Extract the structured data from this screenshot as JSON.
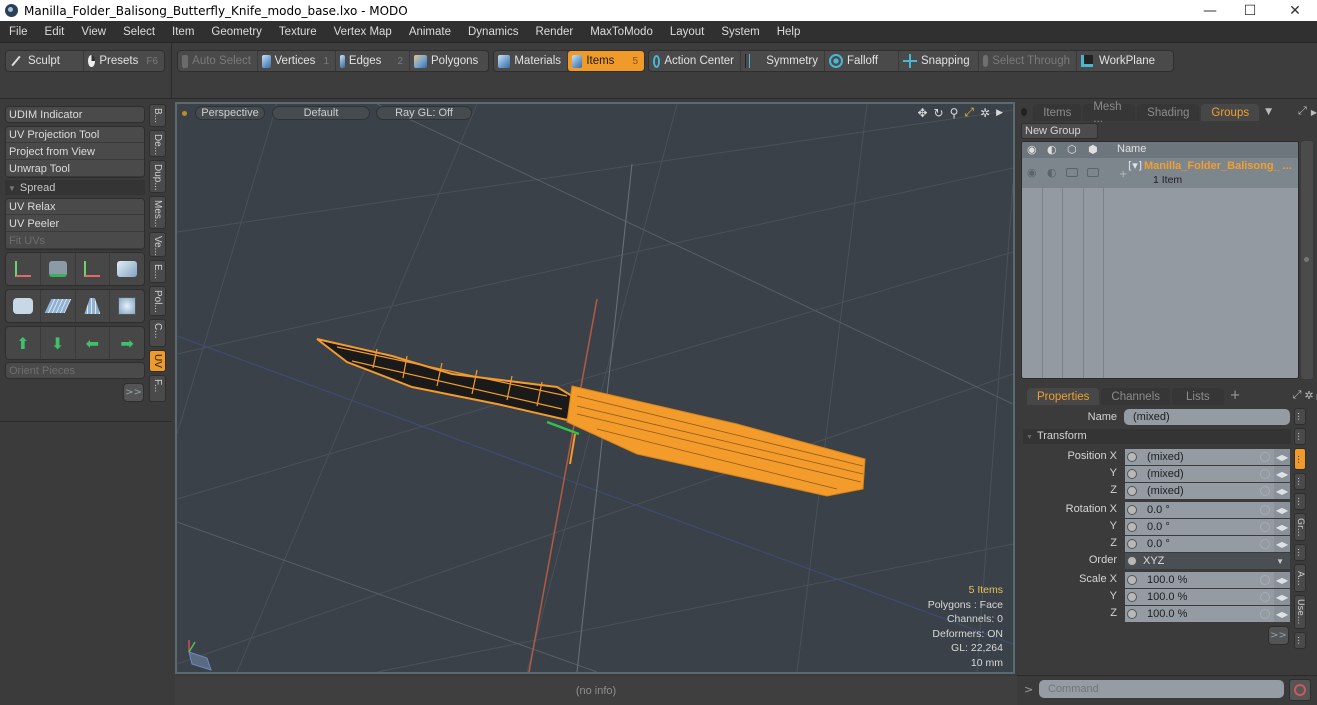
{
  "window": {
    "title": "Manilla_Folder_Balisong_Butterfly_Knife_modo_base.lxo - MODO",
    "controls": {
      "minimize": "—",
      "maximize": "☐",
      "close": "✕"
    }
  },
  "menu": [
    "File",
    "Edit",
    "View",
    "Select",
    "Item",
    "Geometry",
    "Texture",
    "Vertex Map",
    "Animate",
    "Dynamics",
    "Render",
    "MaxToModo",
    "Layout",
    "System",
    "Help"
  ],
  "toolbar": {
    "sculpt": "Sculpt",
    "presets": "Presets",
    "presets_key": "F6",
    "auto_select": "Auto Select",
    "vertices": "Vertices",
    "vertices_key": "1",
    "edges": "Edges",
    "edges_key": "2",
    "polygons": "Polygons",
    "materials": "Materials",
    "items": "Items",
    "items_key": "5",
    "action_center": "Action Center",
    "symmetry": "Symmetry",
    "falloff": "Falloff",
    "snapping": "Snapping",
    "select_through": "Select Through",
    "workplane": "WorkPlane",
    "accent": "#f09a2a"
  },
  "left_panel": {
    "udim": "UDIM Indicator",
    "uv_projection": "UV Projection Tool",
    "project_from_view": "Project from View",
    "unwrap": "Unwrap Tool",
    "spread": "Spread",
    "uv_relax": "UV Relax",
    "uv_peeler": "UV Peeler",
    "fit_uvs": "Fit UVs",
    "orient_pieces": "Orient Pieces",
    "more": ">>",
    "vertical_tabs": [
      "B...",
      "De...",
      "Dup...",
      "Mes...",
      "Ve...",
      "E...",
      "Pol...",
      "C...",
      "UV",
      "F..."
    ],
    "active_tab": "UV"
  },
  "viewport": {
    "view": "Perspective",
    "shading": "Default",
    "raygl": "Ray GL: Off",
    "stats": {
      "items": "5 Items",
      "polygons": "Polygons : Face",
      "channels": "Channels: 0",
      "deformers": "Deformers: ON",
      "gl": "GL: 22,264",
      "unit": "10 mm"
    },
    "wire_color": "#f39b2b"
  },
  "status_bar": {
    "info": "(no info)"
  },
  "groups_panel": {
    "tabs": [
      "Items",
      "Mesh ...",
      "Shading",
      "Groups"
    ],
    "active_tab": "Groups",
    "new_group": "New Group",
    "column_name": "Name",
    "rows": [
      {
        "name": "Manilla_Folder_Balisong_ ...",
        "count": "1 Item"
      }
    ]
  },
  "properties_panel": {
    "tabs": [
      "Properties",
      "Channels",
      "Lists"
    ],
    "active_tab": "Properties",
    "add_tab": "+",
    "name_label": "Name",
    "name_value": "(mixed)",
    "section": "Transform",
    "rows": [
      {
        "label": "Position X",
        "value": "(mixed)"
      },
      {
        "label": "Y",
        "value": "(mixed)"
      },
      {
        "label": "Z",
        "value": "(mixed)"
      },
      {
        "label": "Rotation X",
        "value": "0.0 °"
      },
      {
        "label": "Y",
        "value": "0.0 °"
      },
      {
        "label": "Z",
        "value": "0.0 °"
      },
      {
        "label": "Order",
        "value": "XYZ"
      },
      {
        "label": "Scale X",
        "value": "100.0 %"
      },
      {
        "label": "Y",
        "value": "100.0 %"
      },
      {
        "label": "Z",
        "value": "100.0 %"
      }
    ],
    "more": ">>",
    "side_tabs": [
      "...",
      "...",
      "...",
      "...",
      "...",
      "Gr...",
      "...",
      "A...",
      "Use...",
      "..."
    ]
  },
  "command": {
    "prompt": ">",
    "placeholder": "Command"
  }
}
